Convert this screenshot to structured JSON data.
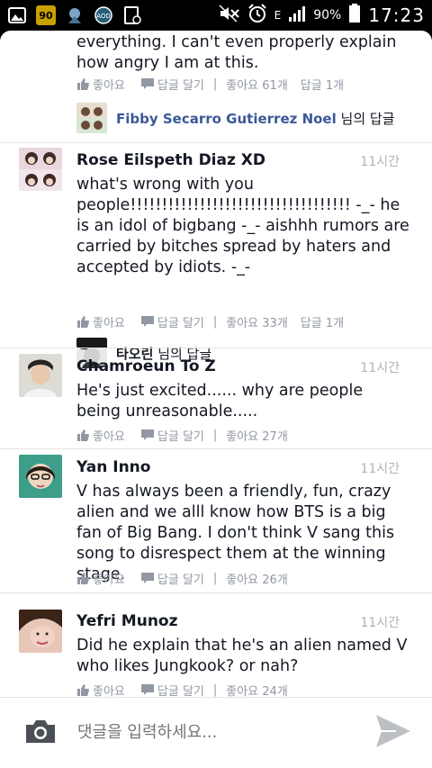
{
  "status_bar": {
    "battery_percent": "90%",
    "time": "17:23",
    "network": "E",
    "left_icons": [
      "gallery-icon",
      "game-icon",
      "app-icon",
      "settings-icon",
      "clipboard-icon"
    ],
    "right_icons": [
      "mute-icon",
      "alarm-icon",
      "signal-icon",
      "battery-icon"
    ]
  },
  "labels": {
    "like": "좋아요",
    "reply": "답글 달기",
    "reply_suffix": "님의 답글"
  },
  "comments": [
    {
      "name": "",
      "time": "",
      "text": "everything. I can't even properly explain how angry I am at this.",
      "likes_text": "좋아요 61개",
      "replies_text": "답글 1개",
      "reply_author": "Fibby Secarro Gutierrez Noel"
    },
    {
      "name": "Rose Eilspeth Diaz XD",
      "time": "11시간",
      "text": "what's wrong with you people!!!!!!!!!!!!!!!!!!!!!!!!!!!!!!!!!!! -_- he is an idol of bigbang -_- aishhh rumors are carried by bitches spread by haters and accepted by idiots. -_-",
      "likes_text": "좋아요 33개",
      "replies_text": "답글 1개",
      "reply_author": "타오린"
    },
    {
      "name": "Chamroeun To Z",
      "time": "11시간",
      "text": "He's just excited...... why are people being unreasonable.....",
      "likes_text": "좋아요 27개"
    },
    {
      "name": "Yan Inno",
      "time": "11시간",
      "text": "V has always been a friendly, fun, crazy alien and we alll know how BTS is a big fan of Big Bang. I don't think V sang this song to disrespect them at the winning stage.",
      "likes_text": "좋아요 26개"
    },
    {
      "name": "Yefri Munoz",
      "time": "11시간",
      "text": "Did he explain that he's an alien named V who likes Jungkook? or nah?",
      "likes_text": "좋아요 24개"
    }
  ],
  "composer": {
    "placeholder": "댓글을 입력하세요..."
  },
  "colors": {
    "text": "#141823",
    "meta": "#9197a3",
    "time": "#b0b3b8",
    "divider": "#e5e5e5"
  }
}
